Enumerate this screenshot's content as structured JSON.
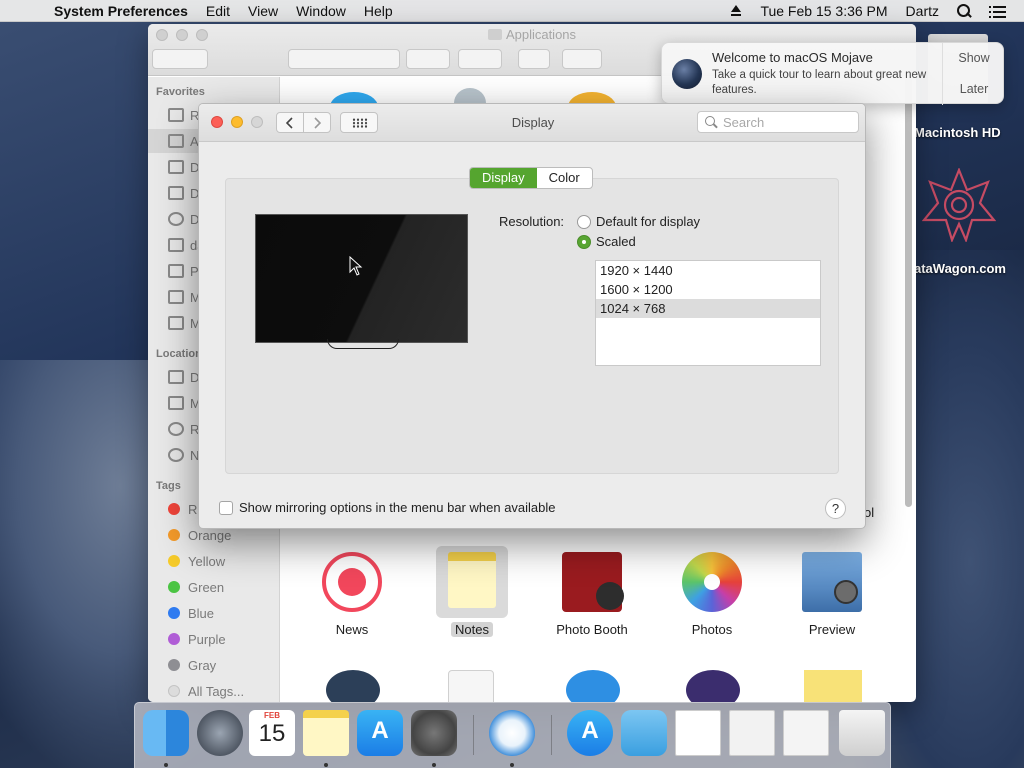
{
  "menubar": {
    "apple": "",
    "app_name": "System Preferences",
    "menus": [
      "Edit",
      "View",
      "Window",
      "Help"
    ],
    "clock": "Tue Feb 15  3:36 PM",
    "user": "Dartz"
  },
  "finder": {
    "title": "Applications",
    "sidebar": {
      "favorites_header": "Favorites",
      "favorites": [
        "R",
        "A",
        "D",
        "D",
        "D",
        "da",
        "P",
        "M",
        "M"
      ],
      "locations_header": "Location",
      "locations": [
        "D",
        "M",
        "R",
        "N"
      ],
      "tags_header": "Tags",
      "tags": [
        {
          "label": "R",
          "color": "#f0443a"
        },
        {
          "label": "Orange",
          "color": "#f39a2a"
        },
        {
          "label": "Yellow",
          "color": "#f6cb2a"
        },
        {
          "label": "Green",
          "color": "#4bc443"
        },
        {
          "label": "Blue",
          "color": "#2f7bf0"
        },
        {
          "label": "Purple",
          "color": "#b05dd6"
        },
        {
          "label": "Gray",
          "color": "#8e8e93"
        },
        {
          "label": "All Tags...",
          "color": "#dcdcdc"
        }
      ]
    },
    "apps": [
      "News",
      "Notes",
      "Photo Booth",
      "Photos",
      "Preview"
    ],
    "partial_label": "ol"
  },
  "notification": {
    "title": "Welcome to macOS Mojave",
    "body": "Take a quick tour to learn about great new features.",
    "show_label": "Show",
    "later_label": "Later"
  },
  "desktop": {
    "hd_label": "Macintosh HD",
    "wagon_label": "ataWagon.com"
  },
  "prefs": {
    "title": "Display",
    "search_placeholder": "Search",
    "tabs": {
      "display": "Display",
      "color": "Color"
    },
    "resolution_label": "Resolution:",
    "radio_default": "Default for display",
    "radio_scaled": "Scaled",
    "resolutions": [
      "1920 × 1440",
      "1600 × 1200",
      "1024 × 768"
    ],
    "selected_resolution": "1024 × 768",
    "mirror_label": "Show mirroring options in the menu bar when available",
    "help_label": "?"
  },
  "dock": {
    "items": [
      "Finder",
      "Launchpad",
      "Calendar",
      "Notes",
      "App Store",
      "System Preferences",
      "Safari",
      "App Store",
      "Downloads",
      "Document",
      "Document",
      "Screenshot",
      "Trash"
    ],
    "calendar_month": "FEB",
    "calendar_day": "15"
  }
}
